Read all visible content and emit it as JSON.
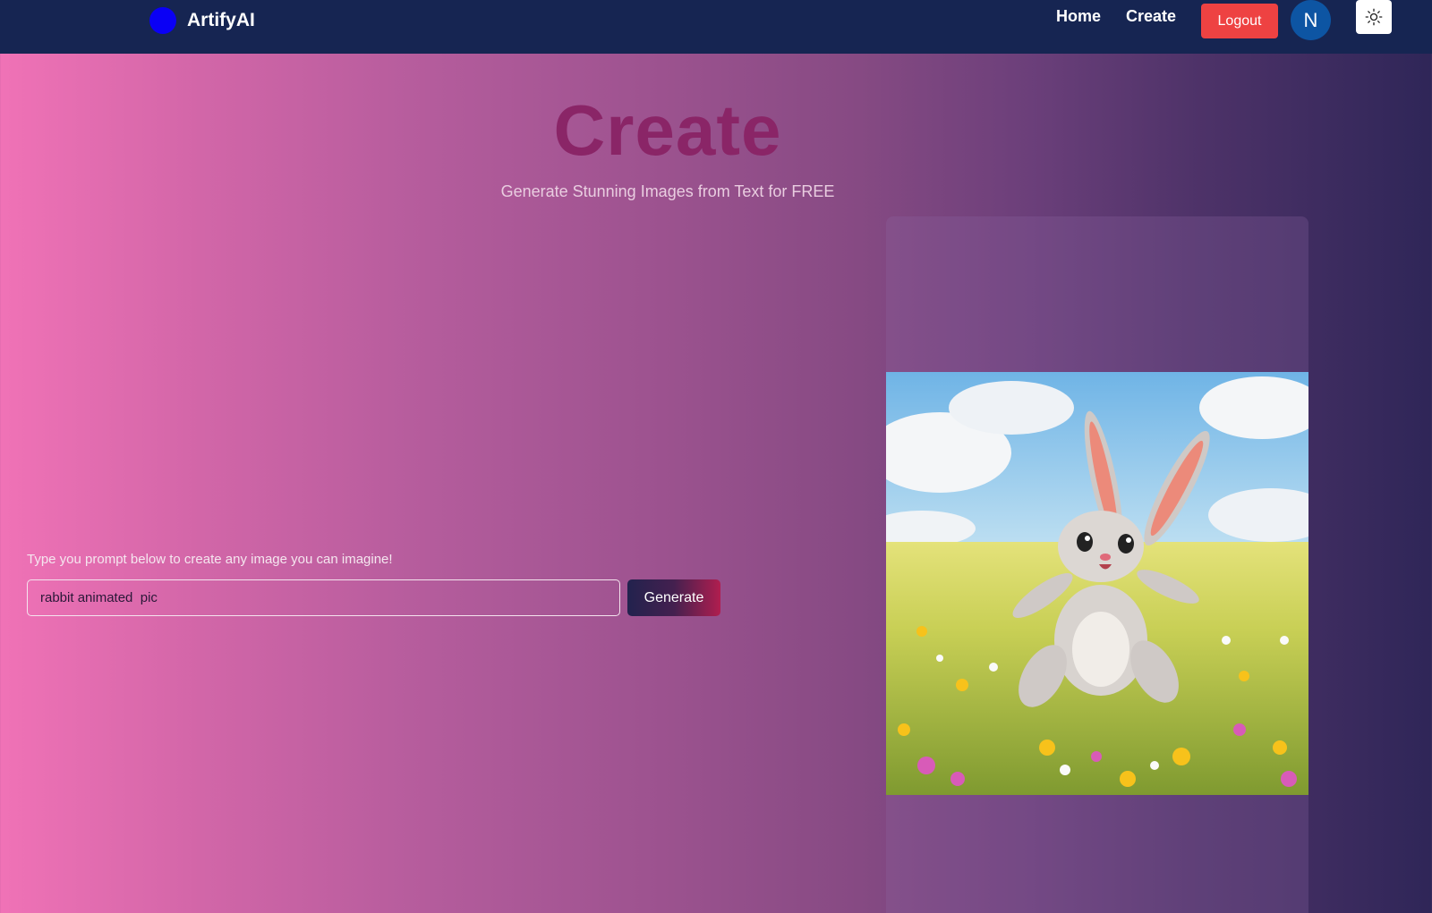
{
  "navbar": {
    "brand_name": "ArtifyAI",
    "links": [
      {
        "label": "Home"
      },
      {
        "label": "Create"
      }
    ],
    "logout_label": "Logout",
    "avatar_initial": "N",
    "theme_icon": "sun-icon"
  },
  "main": {
    "title": "Create",
    "subtitle": "Generate Stunning Images from Text for FREE",
    "prompt_label": "Type you prompt below to create any image you can imagine!",
    "prompt_value": "rabbit animated  pic",
    "generate_label": "Generate",
    "generated_image": "cartoon-rabbit-in-flower-meadow-image"
  },
  "colors": {
    "navbar_bg": "#162552",
    "logout_bg": "#ee4242",
    "avatar_bg": "#0d55a3",
    "brand_dot": "#0a00f5",
    "title_color": "#8a2567"
  }
}
